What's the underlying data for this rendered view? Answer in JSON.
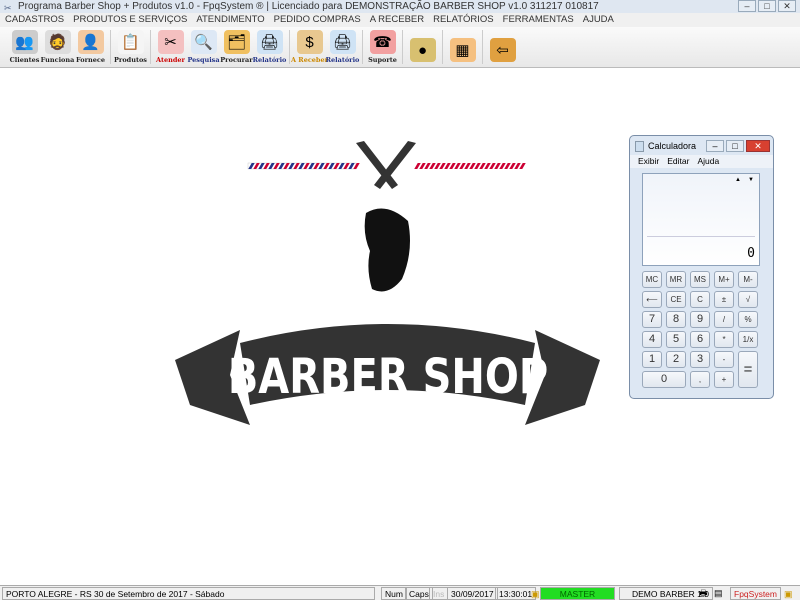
{
  "window": {
    "title": "Programa Barber Shop + Produtos v1.0 - FpqSystem ® | Licenciado para  DEMONSTRAÇÃO BARBER SHOP v1.0 311217 010817"
  },
  "menu": [
    "CADASTROS",
    "PRODUTOS E SERVIÇOS",
    "ATENDIMENTO",
    "PEDIDO COMPRAS",
    "A RECEBER",
    "RELATÓRIOS",
    "FERRAMENTAS",
    "AJUDA"
  ],
  "toolbar": [
    {
      "label": "Clientes",
      "icon": "clients-icon",
      "glyph": "👥",
      "color": "#ccc"
    },
    {
      "label": "Funciona",
      "icon": "employee-icon",
      "glyph": "🧔",
      "color": "#ddd"
    },
    {
      "label": "Fornece",
      "icon": "supplier-icon",
      "glyph": "👤",
      "color": "#f3c9a0"
    },
    {
      "label": "Produtos",
      "icon": "products-icon",
      "glyph": "📋",
      "color": "#f5f5f5"
    },
    {
      "label": "Atender",
      "icon": "service-icon",
      "glyph": "✂",
      "color": "#f4c0c0"
    },
    {
      "label": "Pesquisa",
      "icon": "search-icon",
      "glyph": "🔍",
      "color": "#dde8f5"
    },
    {
      "label": "Procurar",
      "icon": "folder-icon",
      "glyph": "🗂",
      "color": "#f0c060"
    },
    {
      "label": "Relatório",
      "icon": "printer-icon",
      "glyph": "🖨",
      "color": "#cfe3f5"
    },
    {
      "label": "A Receber",
      "icon": "money-icon",
      "glyph": "$",
      "color": "#e8c890"
    },
    {
      "label": "Relatório",
      "icon": "printer-icon",
      "glyph": "🖨",
      "color": "#cfe3f5"
    },
    {
      "label": "Suporte",
      "icon": "support-icon",
      "glyph": "☎",
      "color": "#f2a0a0"
    },
    {
      "label": "",
      "icon": "coin-icon",
      "glyph": "●",
      "color": "#d8c070"
    },
    {
      "label": "",
      "icon": "calculator-icon",
      "glyph": "▦",
      "color": "#f5c080"
    },
    {
      "label": "",
      "icon": "exit-icon",
      "glyph": "⇦",
      "color": "#e0a040"
    }
  ],
  "logo": {
    "text": "BARBER SHOP"
  },
  "calculator": {
    "title": "Calculadora",
    "menu": [
      "Exibir",
      "Editar",
      "Ajuda"
    ],
    "display": "0",
    "buttons": [
      [
        "MC",
        "MR",
        "MS",
        "M+",
        "M-"
      ],
      [
        "⟵",
        "CE",
        "C",
        "±",
        "√"
      ],
      [
        "7",
        "8",
        "9",
        "/",
        "%"
      ],
      [
        "4",
        "5",
        "6",
        "*",
        "1/x"
      ],
      [
        "1",
        "2",
        "3",
        "-",
        "="
      ],
      [
        "0",
        ",",
        "+"
      ]
    ]
  },
  "status": {
    "location": "PORTO ALEGRE - RS 30 de Setembro de 2017 - Sábado",
    "num": "Num",
    "caps": "Caps",
    "ins": "Ins",
    "date": "30/09/2017",
    "time": "13:30:01",
    "user": "MASTER",
    "version": "DEMO BARBER 1.0",
    "brand": "FpqSystem",
    "user_color": "#22dd22",
    "brand_color": "#cc2222"
  }
}
